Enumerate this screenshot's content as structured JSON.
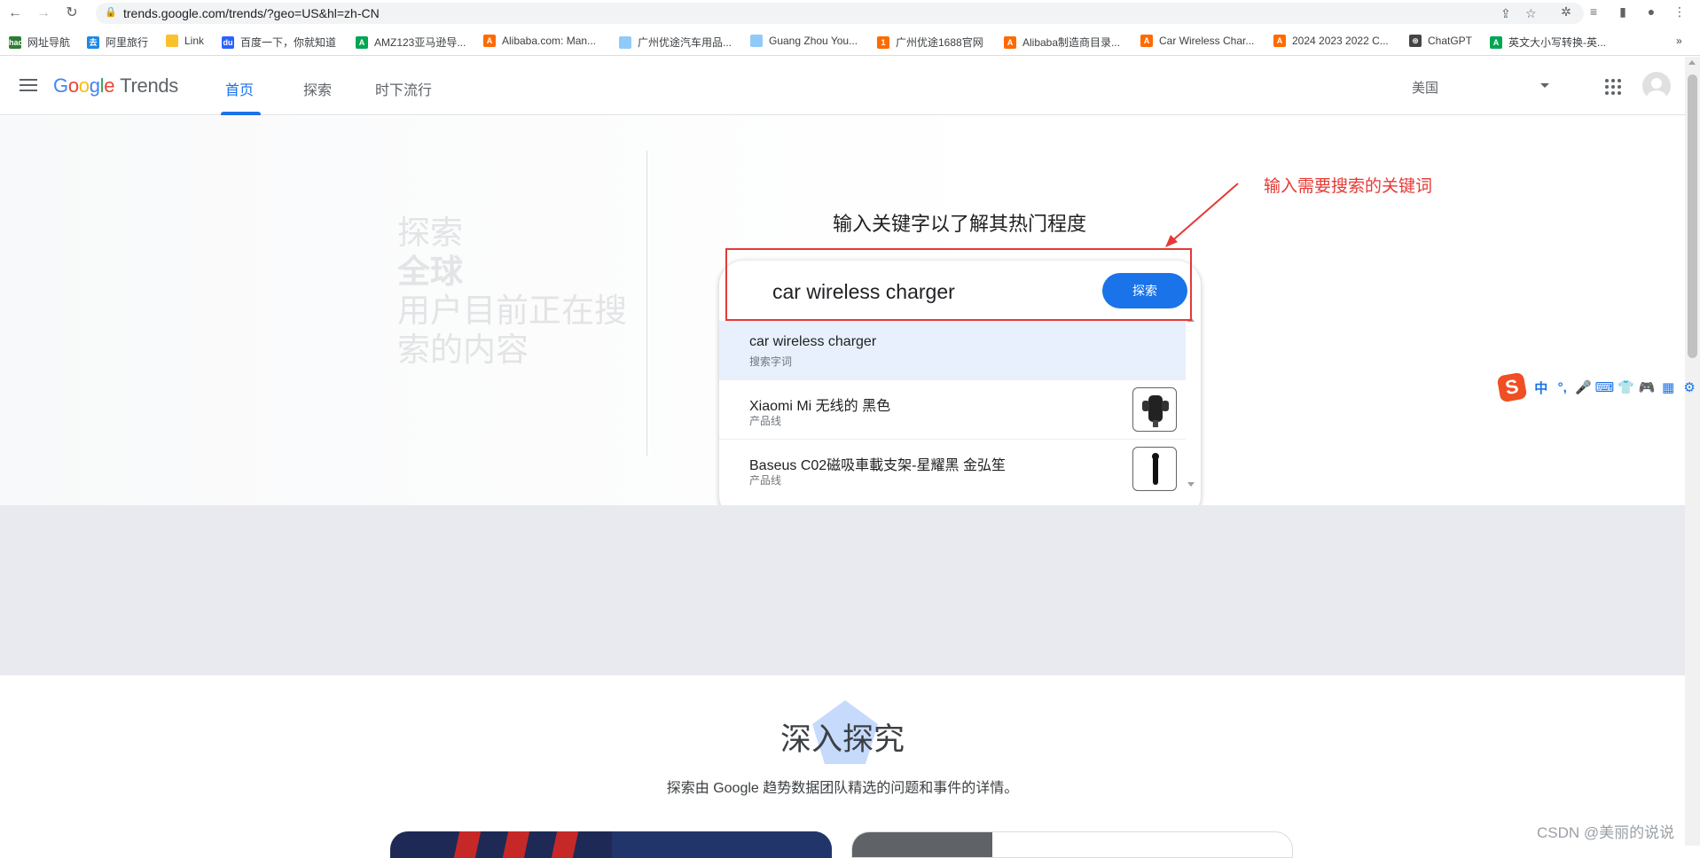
{
  "browser": {
    "url": "trends.google.com/trends/?geo=US&hl=zh-CN",
    "bookmarks": [
      {
        "label": "网址导航",
        "color": "#2e7d32",
        "glyph": "hao"
      },
      {
        "label": "阿里旅行",
        "color": "#1e88e5",
        "glyph": "去"
      },
      {
        "label": "Link",
        "color": "#fbc02d",
        "glyph": ""
      },
      {
        "label": "百度一下，你就知道",
        "color": "#2962ff",
        "glyph": "du"
      },
      {
        "label": "AMZ123亚马逊导...",
        "color": "#00a651",
        "glyph": "A"
      },
      {
        "label": "Alibaba.com: Man...",
        "color": "#ff6a00",
        "glyph": "A"
      },
      {
        "label": "广州优途汽车用品...",
        "color": "#90caf9",
        "glyph": ""
      },
      {
        "label": "Guang Zhou You...",
        "color": "#90caf9",
        "glyph": ""
      },
      {
        "label": "广州优途1688官网",
        "color": "#ff6a00",
        "glyph": "1"
      },
      {
        "label": "Alibaba制造商目录...",
        "color": "#ff6a00",
        "glyph": "A"
      },
      {
        "label": "Car Wireless Char...",
        "color": "#ff6a00",
        "glyph": "A"
      },
      {
        "label": "2024 2023 2022 C...",
        "color": "#ff6a00",
        "glyph": "A"
      },
      {
        "label": "ChatGPT",
        "color": "#444444",
        "glyph": "⊛"
      },
      {
        "label": "英文大小写转换-英...",
        "color": "#00a651",
        "glyph": "A"
      }
    ],
    "more": "»"
  },
  "header": {
    "logo_google": [
      "G",
      "o",
      "o",
      "g",
      "l",
      "e"
    ],
    "logo_trends": "Trends",
    "tabs": [
      "首页",
      "探索",
      "时下流行"
    ],
    "region": "美国"
  },
  "hero": {
    "line1": "探索",
    "line2": "全球",
    "line3": "用户目前正在搜索的内容",
    "prompt": "输入关键字以了解其热门程度",
    "search_value": "car wireless charger",
    "explore_button": "探索",
    "suggestions": [
      {
        "title": "car wireless charger",
        "sub": "搜索字词"
      },
      {
        "title": "Xiaomi Mi 无线的 黑色",
        "sub": "产品线"
      },
      {
        "title": "Baseus C02磁吸車載支架-星耀黑 金弘笙",
        "sub": "产品线"
      }
    ]
  },
  "annotation": {
    "text": "输入需要搜索的关键词",
    "color": "#e53935"
  },
  "ime": {
    "icons": [
      "中",
      "°,",
      "🎤",
      "⌨",
      "👕",
      "🎮",
      "▦",
      "⚙"
    ]
  },
  "deep": {
    "title": "深入探究",
    "subtitle": "探索由 Google 趋势数据团队精选的问题和事件的详情。"
  },
  "watermark": "CSDN @美丽的说说"
}
